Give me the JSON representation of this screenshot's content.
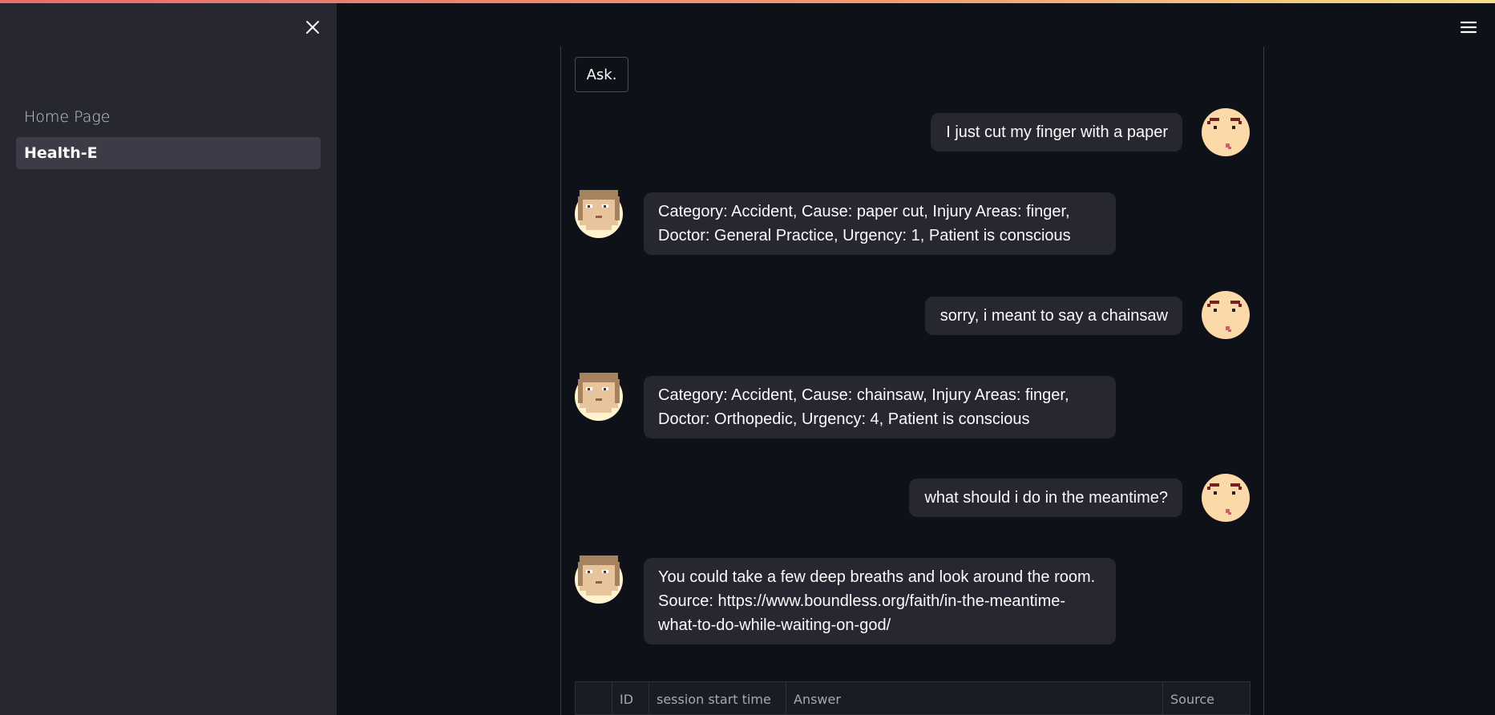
{
  "sidebar": {
    "items": [
      {
        "label": "Home Page",
        "active": false
      },
      {
        "label": "Health-E",
        "active": true
      }
    ],
    "close_icon": "close-icon"
  },
  "header": {
    "menu_icon": "hamburger-menu-icon"
  },
  "main": {
    "ask_button_label": "Ask.",
    "messages": [
      {
        "role": "user",
        "lines": [
          "I just cut my finger with a paper"
        ],
        "avatar": "user-avatar-icon"
      },
      {
        "role": "assistant",
        "lines": [
          "Category: Accident, Cause: paper cut, Injury Areas: finger,",
          "Doctor: General Practice, Urgency: 1, Patient is conscious"
        ],
        "avatar": "assistant-avatar-icon"
      },
      {
        "role": "user",
        "lines": [
          "sorry, i meant to say a chainsaw"
        ],
        "avatar": "user-avatar-icon"
      },
      {
        "role": "assistant",
        "lines": [
          "Category: Accident, Cause: chainsaw, Injury Areas: finger,",
          "Doctor: Orthopedic, Urgency: 4, Patient is conscious"
        ],
        "avatar": "assistant-avatar-icon"
      },
      {
        "role": "user",
        "lines": [
          "what should i do in the meantime?"
        ],
        "avatar": "user-avatar-icon"
      },
      {
        "role": "assistant",
        "lines": [
          "You could take a few deep breaths and look around the room.",
          "Source: https://www.boundless.org/faith/in-the-meantime-",
          "what-to-do-while-waiting-on-god/"
        ],
        "avatar": "assistant-avatar-icon"
      }
    ],
    "table": {
      "columns": [
        "",
        "ID",
        "session start time",
        "Answer",
        "Source"
      ]
    }
  },
  "colors": {
    "background": "#0e1117",
    "sidebar": "#262730",
    "bubble": "#262730",
    "accent_gradient_start": "#e86c6c",
    "accent_gradient_end": "#f5e08a"
  }
}
